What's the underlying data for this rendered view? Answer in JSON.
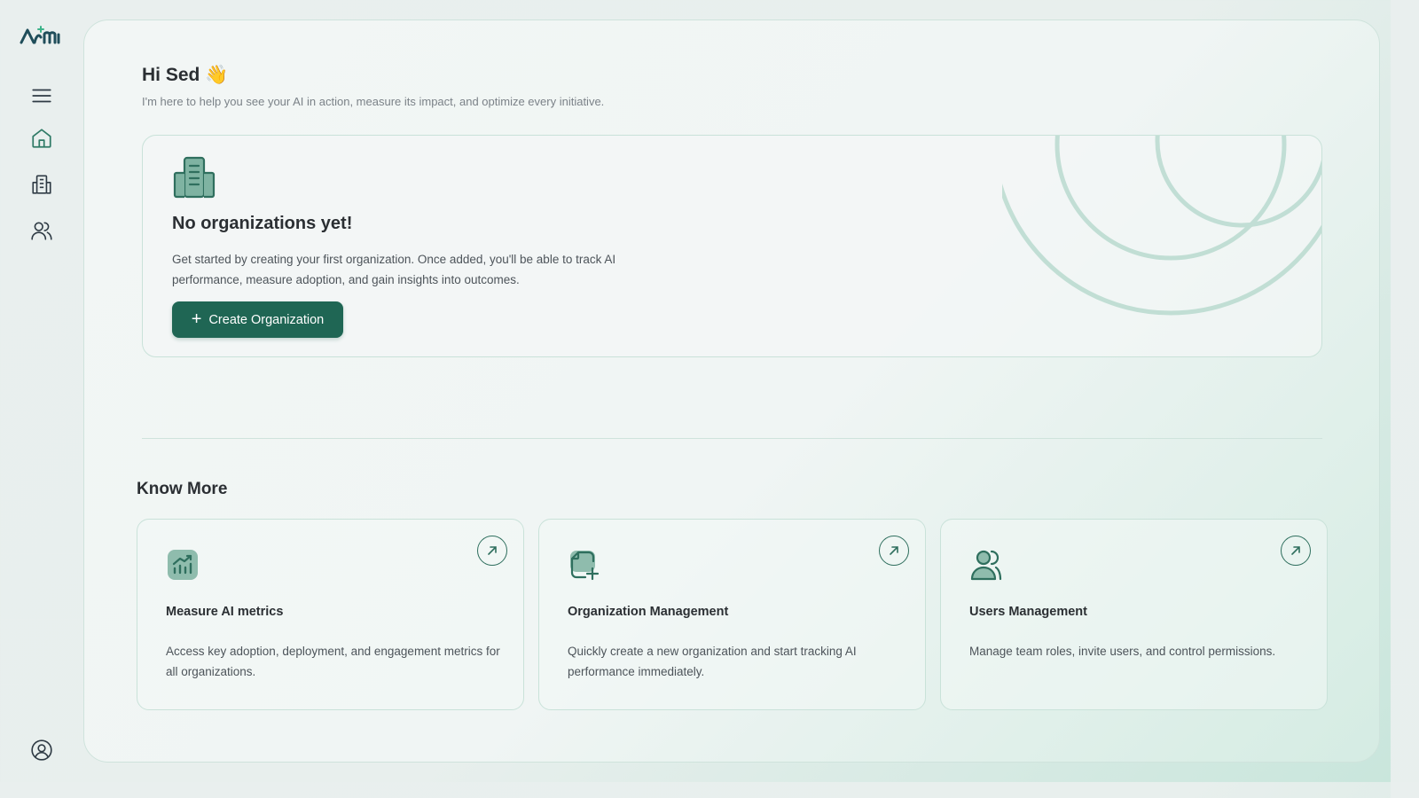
{
  "brand": {
    "logo_text": "AM",
    "accent": "#1f6654",
    "icon_color": "#2f6f5e"
  },
  "sidebar": {
    "items": [
      {
        "name": "menu",
        "icon": "hamburger-icon"
      },
      {
        "name": "home",
        "icon": "home-icon"
      },
      {
        "name": "organizations",
        "icon": "building-icon"
      },
      {
        "name": "users",
        "icon": "users-icon"
      }
    ],
    "profile_icon": "user-circle-icon"
  },
  "header": {
    "greeting": "Hi Sed",
    "wave": "👋",
    "subtitle": "I'm here to help you see your AI in action, measure its impact, and optimize every initiative."
  },
  "empty_state": {
    "title": "No organizations yet!",
    "description": "Get started by creating your first organization. Once added, you'll be able to track AI performance, measure adoption, and gain insights into outcomes.",
    "button_label": "Create Organization"
  },
  "know_more": {
    "title": "Know More",
    "cards": [
      {
        "title": "Measure AI metrics",
        "description": "Access key adoption, deployment, and engagement metrics for all organizations.",
        "icon": "chart-icon"
      },
      {
        "title": "Organization Management",
        "description": "Quickly create a new organization and start tracking AI performance immediately.",
        "icon": "add-document-icon"
      },
      {
        "title": "Users Management",
        "description": "Manage team roles, invite users, and control permissions.",
        "icon": "users-icon"
      }
    ]
  }
}
